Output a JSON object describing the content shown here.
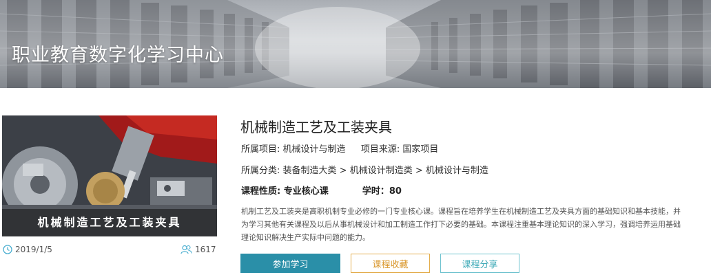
{
  "banner": {
    "title": "职业教育数字化学习中心"
  },
  "course": {
    "thumbnail_caption": "机械制造工艺及工装夹具",
    "date": "2019/1/5",
    "learner_count": "1617",
    "title": "机械制造工艺及工装夹具",
    "project_label": "所属项目:",
    "project_value": "机械设计与制造",
    "source_label": "项目来源:",
    "source_value": "国家项目",
    "category_label": "所属分类:",
    "category_path": "装备制造大类 > 机械设计制造类 > 机械设计与制造",
    "nature_label": "课程性质:",
    "nature_value": "专业核心课",
    "hours_label": "学时：",
    "hours_value": "80",
    "description": "机制工艺及工装夹是高职机制专业必修的一门专业核心课。课程旨在培养学生在机械制造工艺及夹具方面的基础知识和基本技能，并为学习其他有关课程及以后从事机械设计和加工制造工作打下必要的基础。本课程注重基本理论知识的深入学习，强调培养运用基础理论知识解决生产实际中问题的能力。"
  },
  "actions": {
    "join_label": "参加学习",
    "favorite_label": "课程收藏",
    "share_label": "课程分享"
  },
  "icons": {
    "date": "clock-icon",
    "learners": "users-icon"
  },
  "colors": {
    "primary": "#2a8fa8",
    "favorite": "#e3ad4c",
    "share": "#6fc3cf",
    "meta_icon": "#4aaed0"
  }
}
